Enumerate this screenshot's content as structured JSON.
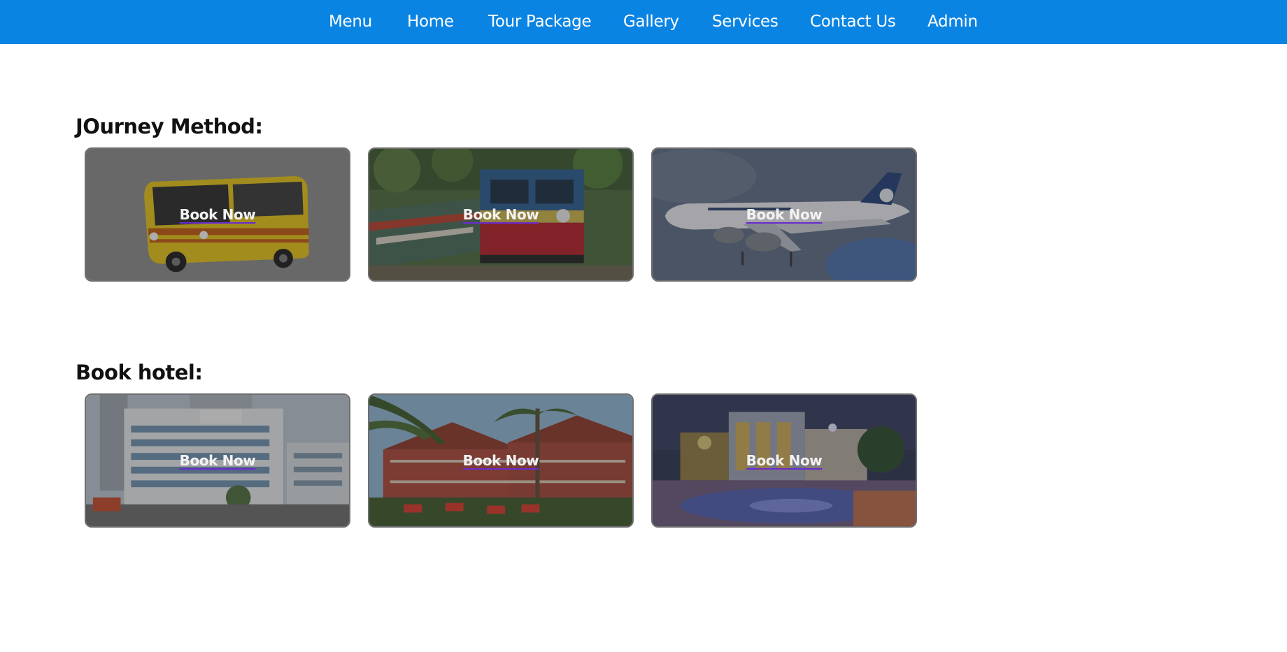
{
  "nav": {
    "items": [
      {
        "label": "Menu"
      },
      {
        "label": "Home"
      },
      {
        "label": "Tour Package"
      },
      {
        "label": "Gallery"
      },
      {
        "label": "Services"
      },
      {
        "label": "Contact Us"
      },
      {
        "label": "Admin"
      }
    ],
    "background": "#0a84e3"
  },
  "journey": {
    "title": "JOurney Method:",
    "cards": [
      {
        "image": "bus-photo",
        "cta": "Book Now"
      },
      {
        "image": "train-photo",
        "cta": "Book Now"
      },
      {
        "image": "airplane-photo",
        "cta": "Book Now"
      }
    ]
  },
  "hotel": {
    "title": "Book hotel:",
    "cards": [
      {
        "image": "hotel-building-photo",
        "cta": "Book Now"
      },
      {
        "image": "resort-photo",
        "cta": "Book Now"
      },
      {
        "image": "hotel-pool-photo",
        "cta": "Book Now"
      }
    ]
  }
}
